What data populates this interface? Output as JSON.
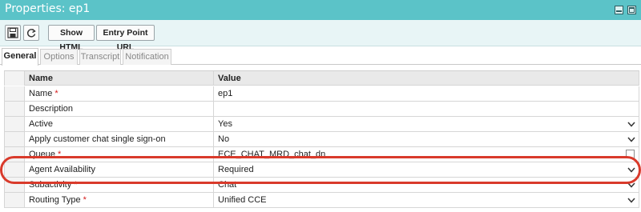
{
  "window": {
    "title": "Properties: ep1"
  },
  "toolbar": {
    "save_icon": "save-icon",
    "refresh_icon": "refresh-icon",
    "show_html_label": "Show HTML",
    "entry_point_url_label": "Entry Point URL"
  },
  "tabs": [
    {
      "label": "General",
      "active": true
    },
    {
      "label": "Options",
      "active": false
    },
    {
      "label": "Transcript",
      "active": false
    },
    {
      "label": "Notification",
      "active": false
    }
  ],
  "grid": {
    "headers": {
      "name": "Name",
      "value": "Value"
    },
    "rows": [
      {
        "name": "Name",
        "required": true,
        "value": "ep1",
        "control": "text"
      },
      {
        "name": "Description",
        "required": false,
        "value": "",
        "control": "text"
      },
      {
        "name": "Active",
        "required": false,
        "value": "Yes",
        "control": "dropdown"
      },
      {
        "name": "Apply customer chat single sign-on",
        "required": false,
        "value": "No",
        "control": "dropdown"
      },
      {
        "name": "Queue",
        "required": true,
        "value": "ECE_CHAT_MRD_chat_dn",
        "control": "lookup"
      },
      {
        "name": "Agent Availability",
        "required": false,
        "value": "Required",
        "control": "dropdown"
      },
      {
        "name": "Subactivity",
        "required": true,
        "value": "Chat",
        "control": "dropdown"
      },
      {
        "name": "Routing Type",
        "required": true,
        "value": "Unified CCE",
        "control": "dropdown"
      }
    ]
  },
  "required_marker": "*",
  "colors": {
    "titlebar": "#5bc3c8",
    "toolbar": "#e8f5f6",
    "required": "#d61c1c",
    "highlight": "#d93a2b"
  },
  "annotation": {
    "highlighted_row": "Agent Availability"
  }
}
